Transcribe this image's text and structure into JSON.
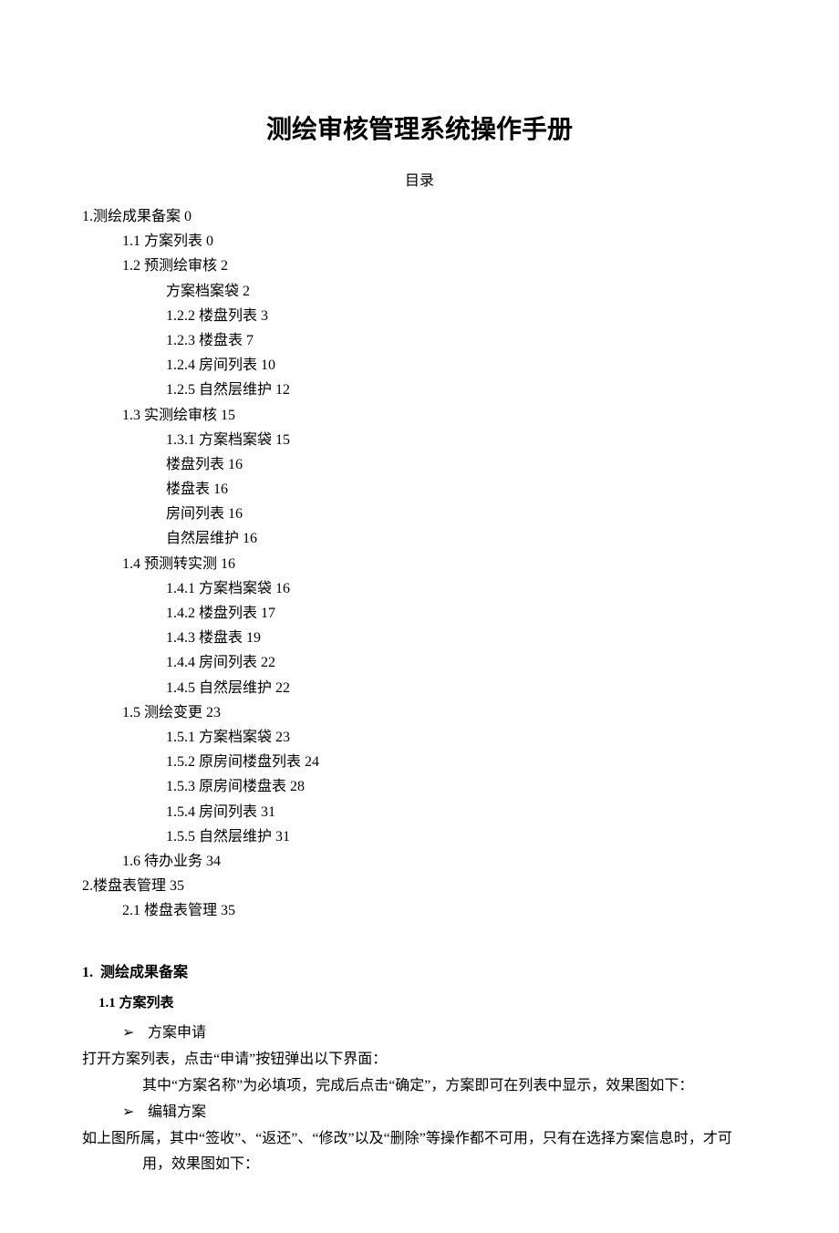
{
  "title": "测绘审核管理系统操作手册",
  "toc_header": "目录",
  "toc": [
    {
      "level": 1,
      "label": "1.测绘成果备案",
      "page": "0"
    },
    {
      "level": 2,
      "label": "1.1  方案列表",
      "page": "0"
    },
    {
      "level": 2,
      "label": "1.2  预测绘审核",
      "page": "2"
    },
    {
      "level": 3,
      "label": "方案档案袋",
      "page": "2"
    },
    {
      "level": 3,
      "label": "1.2.2  楼盘列表",
      "page": "3"
    },
    {
      "level": 3,
      "label": "1.2.3  楼盘表",
      "page": "7"
    },
    {
      "level": 3,
      "label": "1.2.4  房间列表",
      "page": "10"
    },
    {
      "level": 3,
      "label": "1.2.5  自然层维护",
      "page": "12"
    },
    {
      "level": 2,
      "label": "1.3  实测绘审核",
      "page": "15"
    },
    {
      "level": 3,
      "label": "1.3.1  方案档案袋",
      "page": "15"
    },
    {
      "level": 3,
      "label": "楼盘列表",
      "page": "16"
    },
    {
      "level": 3,
      "label": "楼盘表",
      "page": "16"
    },
    {
      "level": 3,
      "label": "房间列表",
      "page": "16"
    },
    {
      "level": 3,
      "label": "自然层维护",
      "page": "16"
    },
    {
      "level": 2,
      "label": "1.4  预测转实测",
      "page": "16"
    },
    {
      "level": 3,
      "label": "1.4.1  方案档案袋",
      "page": "16"
    },
    {
      "level": 3,
      "label": "1.4.2  楼盘列表",
      "page": "17"
    },
    {
      "level": 3,
      "label": "1.4.3  楼盘表",
      "page": "19"
    },
    {
      "level": 3,
      "label": "1.4.4  房间列表",
      "page": "22"
    },
    {
      "level": 3,
      "label": "1.4.5  自然层维护",
      "page": "22"
    },
    {
      "level": 2,
      "label": "1.5  测绘变更",
      "page": "23"
    },
    {
      "level": 3,
      "label": "1.5.1  方案档案袋",
      "page": "23"
    },
    {
      "level": 3,
      "label": "1.5.2  原房间楼盘列表",
      "page": "24"
    },
    {
      "level": 3,
      "label": "1.5.3  原房间楼盘表",
      "page": "28"
    },
    {
      "level": 3,
      "label": "1.5.4  房间列表",
      "page": "31"
    },
    {
      "level": 3,
      "label": "1.5.5  自然层维护",
      "page": "31"
    },
    {
      "level": 2,
      "label": "1.6  待办业务",
      "page": "34"
    },
    {
      "level": 1,
      "label": "2.楼盘表管理",
      "page": "35"
    },
    {
      "level": 2,
      "label": "2.1 楼盘表管理",
      "page": "35"
    }
  ],
  "section1": {
    "number": "1.",
    "title": "测绘成果备案",
    "subsection": {
      "number": "1.1",
      "title": "方案列表"
    },
    "bullet1": "方案申请",
    "text1": "打开方案列表，点击“申请”按钮弹出以下界面：",
    "text2": "其中“方案名称”为必填项，完成后点击“确定”，方案即可在列表中显示，效果图如下：",
    "bullet2": "编辑方案",
    "text3": "如上图所属，其中“签收”、“返还”、“修改”以及“删除”等操作都不可用，只有在选择方案信息时，才可用，效果图如下："
  },
  "arrow": "➢"
}
